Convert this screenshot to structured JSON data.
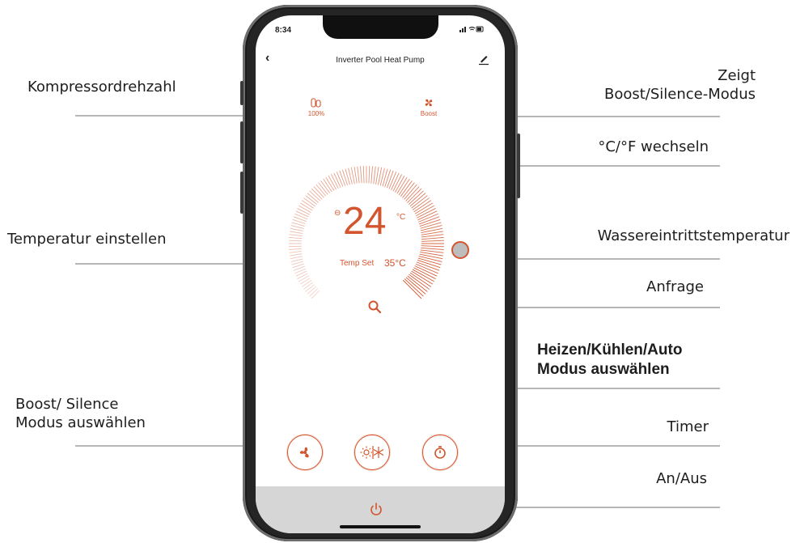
{
  "status_bar": {
    "time": "8:34",
    "icons": "••• ◉ ▮"
  },
  "nav": {
    "back_glyph": "‹",
    "title": "Inverter Pool Heat Pump"
  },
  "compressor": {
    "value": "100%",
    "icon": "compressor-icon"
  },
  "mode_status": {
    "value": "Boost",
    "icon": "fan-icon"
  },
  "temperature": {
    "value": "24",
    "unit": "°C",
    "minus_glyph": "⊖",
    "set_label": "Temp Set",
    "water_inlet": "35°C"
  },
  "annotations": {
    "kompressor": "Kompressordrehzahl",
    "zeigt_1": "Zeigt",
    "zeigt_2": "Boost/Silence-Modus",
    "unit_switch": "°C/°F wechseln",
    "temp_set": "Temperatur einstellen",
    "water_inlet": "Wassereintrittstemperatur",
    "query": "Anfrage",
    "mode_select_1": "Heizen/Kühlen/Auto",
    "mode_select_2": "Modus auswählen",
    "boost_silence_1": "Boost/ Silence",
    "boost_silence_2": "Modus auswählen",
    "timer": "Timer",
    "power": "An/Aus"
  },
  "colors": {
    "accent": "#d2552d",
    "accent_light": "#f4b89c",
    "bar": "#d6d6d6",
    "callout_line": "#8a8a8a"
  }
}
